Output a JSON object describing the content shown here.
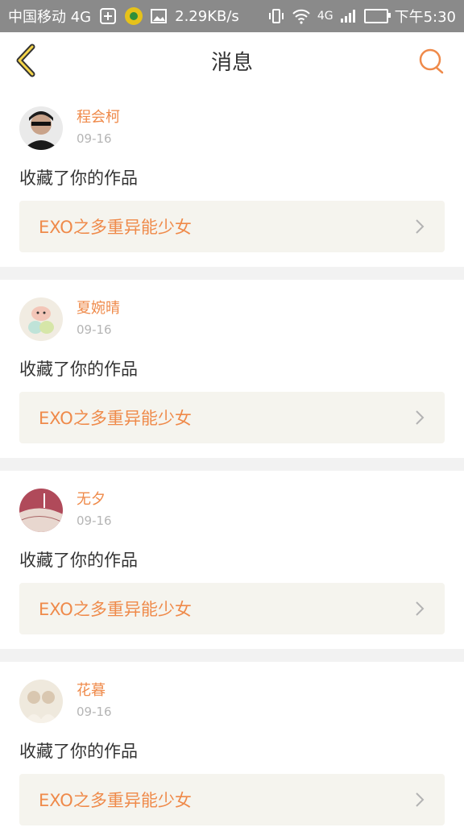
{
  "status_bar": {
    "carrier": "中国移动 4G",
    "speed": "2.29KB/s",
    "network": "4G",
    "time": "下午5:30",
    "icons": [
      "plus-box-icon",
      "app-badge-icon",
      "image-icon",
      "vibrate-icon",
      "wifi-icon",
      "signal-icon",
      "battery-charging-icon"
    ]
  },
  "header": {
    "title": "消息",
    "back_icon": "back-chevron-icon",
    "search_icon": "search-icon",
    "accent": "#ef8a4a"
  },
  "feed": {
    "items": [
      {
        "username": "程会柯",
        "date": "09-16",
        "action": "收藏了你的作品",
        "work_title": "EXO之多重异能少女"
      },
      {
        "username": "夏婉晴",
        "date": "09-16",
        "action": "收藏了你的作品",
        "work_title": "EXO之多重异能少女"
      },
      {
        "username": "无夕",
        "date": "09-16",
        "action": "收藏了你的作品",
        "work_title": "EXO之多重异能少女"
      },
      {
        "username": "花暮",
        "date": "09-16",
        "action": "收藏了你的作品",
        "work_title": "EXO之多重异能少女"
      }
    ]
  }
}
